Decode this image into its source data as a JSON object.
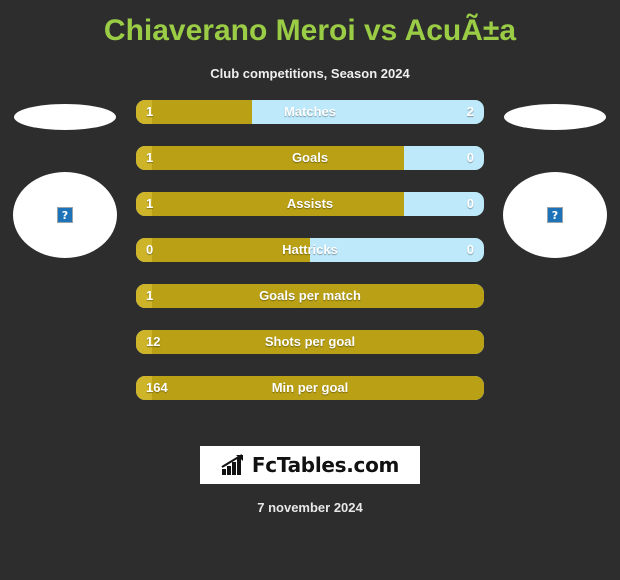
{
  "header": {
    "title": "Chiaverano Meroi vs AcuÃ±a",
    "subtitle": "Club competitions, Season 2024"
  },
  "players": {
    "home": {
      "photo_alt": "broken-image",
      "photo_glyph": "?"
    },
    "away": {
      "photo_alt": "broken-image",
      "photo_glyph": "?"
    }
  },
  "colors": {
    "background": "#2d2d2d",
    "title": "#9acd45",
    "home_bar": "#b9a014",
    "home_bar_cap": "#cdb429",
    "away_bar": "#bde9fb",
    "text": "#ffffff"
  },
  "footer": {
    "logo_text": "FcTables.com",
    "date": "7 november 2024"
  },
  "chart_data": {
    "type": "bar",
    "title": "Chiaverano Meroi vs AcuÃ±a",
    "subtitle": "Club competitions, Season 2024",
    "orientation": "horizontal-diverging",
    "series": [
      {
        "name": "Chiaverano Meroi",
        "color": "#b9a014"
      },
      {
        "name": "AcuÃ±a",
        "color": "#bde9fb"
      }
    ],
    "rows": [
      {
        "label": "Matches",
        "home": "1",
        "away": "2",
        "home_pct": 33.3,
        "split": true
      },
      {
        "label": "Goals",
        "home": "1",
        "away": "0",
        "home_pct": 77.0,
        "split": true
      },
      {
        "label": "Assists",
        "home": "1",
        "away": "0",
        "home_pct": 77.0,
        "split": true
      },
      {
        "label": "Hattricks",
        "home": "0",
        "away": "0",
        "home_pct": 50.0,
        "split": true
      },
      {
        "label": "Goals per match",
        "home": "1",
        "away": "",
        "home_pct": 100,
        "split": false
      },
      {
        "label": "Shots per goal",
        "home": "12",
        "away": "",
        "home_pct": 100,
        "split": false
      },
      {
        "label": "Min per goal",
        "home": "164",
        "away": "",
        "home_pct": 100,
        "split": false
      }
    ]
  }
}
